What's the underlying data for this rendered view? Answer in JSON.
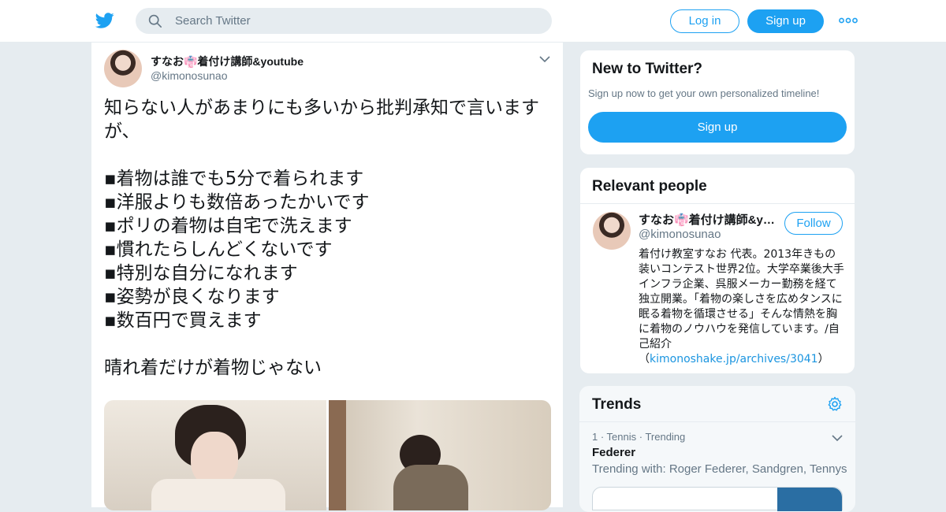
{
  "header": {
    "search_placeholder": "Search Twitter",
    "login_label": "Log in",
    "signup_label": "Sign up",
    "brand_color": "#1da1f2"
  },
  "tweet": {
    "author_name": "すなお👘着付け講師&youtube",
    "author_handle": "@kimonosunao",
    "lines": [
      "知らない人があまりにも多いから批判承知で言います",
      "が、",
      "",
      "▪︎着物は誰でも5分で着られます",
      "▪︎洋服よりも数倍あったかいです",
      "▪︎ポリの着物は自宅で洗えます",
      "▪︎慣れたらしんどくないです",
      "▪︎特別な自分になれます",
      "▪︎姿勢が良くなります",
      "▪︎数百円で買えます",
      "",
      "晴れ着だけが着物じゃない"
    ]
  },
  "sidebar": {
    "new_to_twitter": {
      "title": "New to Twitter?",
      "subtitle": "Sign up now to get your own personalized timeline!",
      "button": "Sign up"
    },
    "relevant_people": {
      "title": "Relevant people",
      "person": {
        "name": "すなお👘着付け講師&y…",
        "handle": "@kimonosunao",
        "follow_label": "Follow",
        "bio": "着付け教室すなお 代表。2013年きもの装いコンテスト世界2位。大学卒業後大手インフラ企業、呉服メーカー勤務を経て独立開業。「着物の楽しさを広めタンスに眠る着物を循環させる」そんな情熱を胸に着物のノウハウを発信しています。/自己紹介（",
        "bio_link": "kimonoshake.jp/archives/3041",
        "bio_end": "）"
      }
    },
    "trends": {
      "title": "Trends",
      "items": [
        {
          "meta": "1 · Tennis · Trending",
          "name": "Federer",
          "with": "Trending with: Roger Federer, Sandgren, Tennys"
        }
      ]
    }
  }
}
